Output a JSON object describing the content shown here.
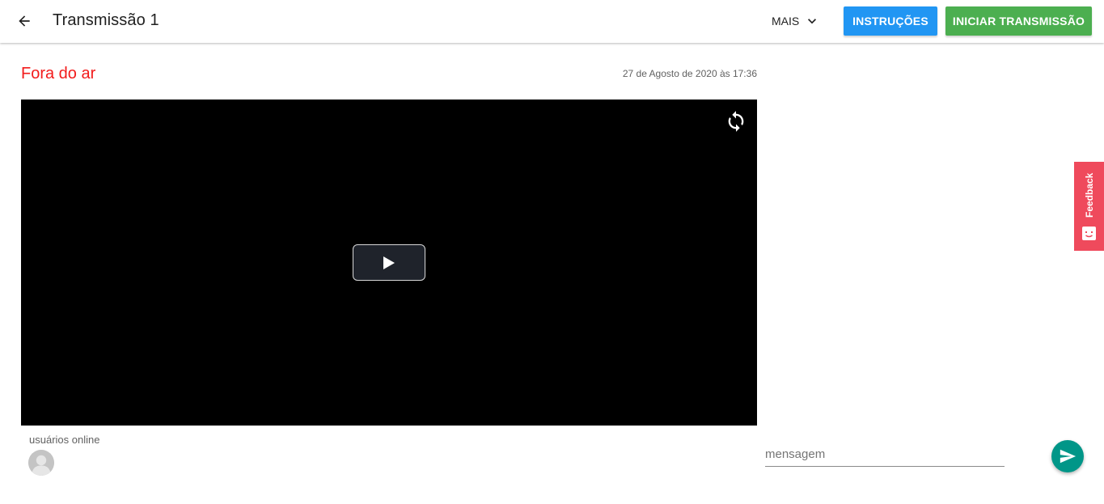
{
  "header": {
    "title": "Transmissão 1",
    "more_label": "MAIS",
    "instructions_label": "INSTRUÇÕES",
    "start_label": "INICIAR TRANSMISSÃO"
  },
  "stream": {
    "status": "Fora do ar",
    "datetime": "27 de Agosto de 2020 às 17:36"
  },
  "users": {
    "label": "usuários online"
  },
  "chat": {
    "placeholder": "mensagem"
  },
  "feedback": {
    "label": "Feedback"
  },
  "colors": {
    "instructions": "#2196f3",
    "start": "#4caf50",
    "status_offline": "#f21b1b",
    "send": "#009688",
    "feedback": "#ef4a5c"
  },
  "icons": [
    "arrow-back-icon",
    "chevron-down-icon",
    "reload-icon",
    "play-icon",
    "avatar-icon",
    "send-icon",
    "feedback-face-icon"
  ]
}
